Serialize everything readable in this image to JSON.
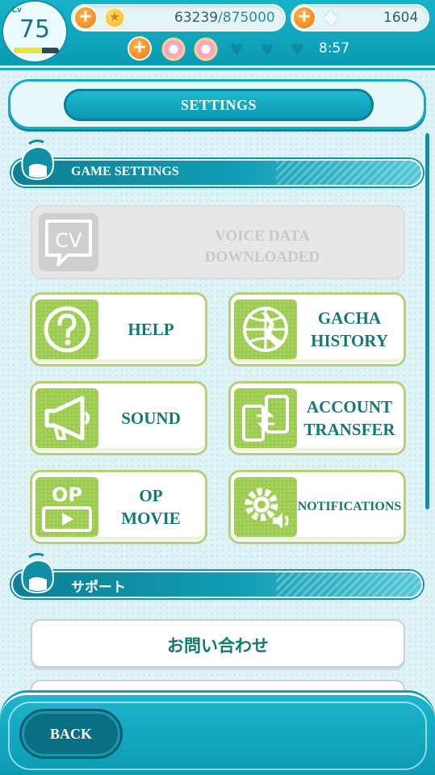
{
  "hud": {
    "level_tag": "Lv",
    "level": "75",
    "xp_fraction": 0.62,
    "coins_current": "63239",
    "coins_cap": "/875000",
    "gems": "1604",
    "stamina_timer": "8:57",
    "plus_symbol": "+",
    "coin_symbol": "★",
    "gem_symbol": "◆",
    "heart_symbol": "♥"
  },
  "header": {
    "title": "SETTINGS"
  },
  "game_settings": {
    "section_title": "GAME SETTINGS",
    "voice": {
      "label_line1": "VOICE DATA",
      "label_line2": "DOWNLOADED",
      "icon_text": "CV"
    },
    "tiles": [
      {
        "line1": "HELP",
        "line2": ""
      },
      {
        "line1": "GACHA",
        "line2": "HISTORY"
      },
      {
        "line1": "SOUND",
        "line2": ""
      },
      {
        "line1": "ACCOUNT",
        "line2": "TRANSFER"
      },
      {
        "line1": "OP",
        "line2": "MOVIE",
        "icon_text": "OP"
      },
      {
        "line1": "NOTIFICATIONS",
        "line2": ""
      }
    ]
  },
  "support": {
    "section_title": "サポート",
    "items": [
      "お問い合わせ"
    ]
  },
  "footer": {
    "back_label": "BACK"
  },
  "colors": {
    "accent": "#0b9ab3",
    "tile_green": "#9ccc4f",
    "tile_text": "#127a74",
    "coin_orange": "#f07b12"
  }
}
